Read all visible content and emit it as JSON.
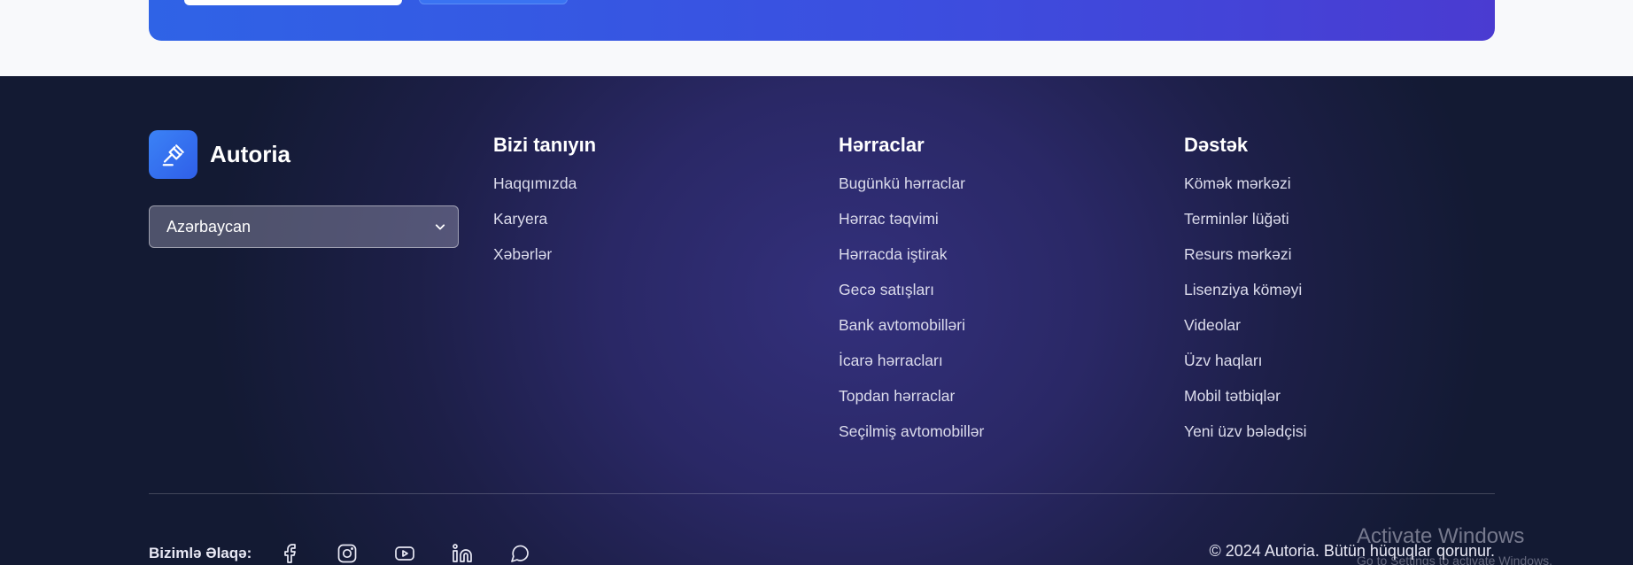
{
  "brand": {
    "name": "Autoria",
    "logo_icon": "gavel-icon"
  },
  "language_select": {
    "selected": "Azərbaycan"
  },
  "columns": [
    {
      "title": "Bizi tanıyın",
      "links": [
        "Haqqımızda",
        "Karyera",
        "Xəbərlər"
      ]
    },
    {
      "title": "Hərraclar",
      "links": [
        "Bugünkü hərraclar",
        "Hərrac təqvimi",
        "Hərracda iştirak",
        "Gecə satışları",
        "Bank avtomobilləri",
        "İcarə hərracları",
        "Topdan hərraclar",
        "Seçilmiş avtomobillər"
      ]
    },
    {
      "title": "Dəstək",
      "links": [
        "Kömək mərkəzi",
        "Terminlər lüğəti",
        "Resurs mərkəzi",
        "Lisenziya köməyi",
        "Videolar",
        "Üzv haqları",
        "Mobil tətbiqlər",
        "Yeni üzv bələdçisi"
      ]
    }
  ],
  "contact": {
    "label": "Bizimlə Əlaqə:",
    "socials": [
      "facebook-icon",
      "instagram-icon",
      "youtube-icon",
      "linkedin-icon",
      "chat-icon"
    ]
  },
  "copyright": "© 2024 Autoria. Bütün hüquqlar qorunur.",
  "watermark": {
    "title": "Activate Windows",
    "subtitle": "Go to Settings to activate Windows."
  },
  "colors": {
    "banner_start": "#2f63e6",
    "banner_end": "#4a3bd1",
    "footer_bg": "#1d1f48",
    "accent": "#3b82f6"
  }
}
